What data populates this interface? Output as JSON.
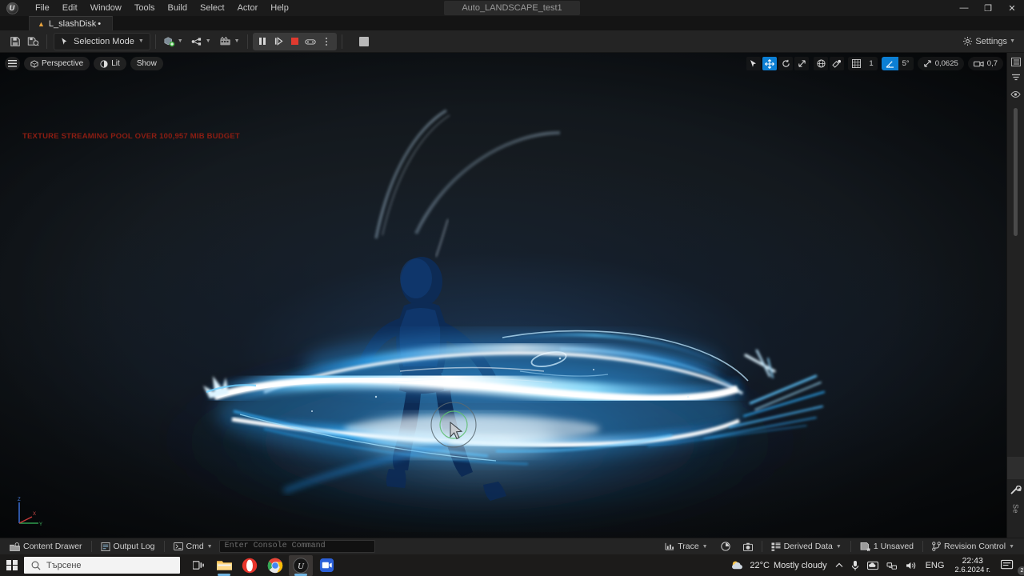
{
  "window": {
    "title": "Auto_LANDSCAPE_test1",
    "minimize": "—",
    "maximize": "❐",
    "close": "✕"
  },
  "menubar": {
    "items": [
      {
        "label": "File"
      },
      {
        "label": "Edit"
      },
      {
        "label": "Window"
      },
      {
        "label": "Tools"
      },
      {
        "label": "Build"
      },
      {
        "label": "Select"
      },
      {
        "label": "Actor"
      },
      {
        "label": "Help"
      }
    ]
  },
  "tab": {
    "label": "L_slashDisk",
    "dirty_marker": "•"
  },
  "toolbar": {
    "save_tooltip": "Save",
    "save_all_tooltip": "Save All",
    "selection_mode": "Selection Mode",
    "add_tooltip": "Add",
    "blueprints_tooltip": "Blueprints",
    "cinematics_tooltip": "Cinematics",
    "pause_tooltip": "Pause",
    "step_tooltip": "Frame Step",
    "stop_tooltip": "Stop",
    "eject_tooltip": "Eject / Possess",
    "more_tooltip": "More Options",
    "settings": "Settings"
  },
  "viewport": {
    "menu_tooltip": "Viewport Options",
    "perspective": "Perspective",
    "view_mode": "Lit",
    "show": "Show",
    "warning": "TEXTURE STREAMING POOL OVER 100,957 MIB BUDGET",
    "tools": {
      "select_tooltip": "Select Mode",
      "move_tooltip": "Translate Mode",
      "rotate_tooltip": "Rotate Mode",
      "scale_tooltip": "Scale Mode",
      "coordinate_tooltip": "World Coordinate System",
      "surface_snap_tooltip": "Surface Snapping",
      "grid_snap_tooltip": "Grid Snapping",
      "grid_value": "1",
      "angle_snap_tooltip": "Angle Snapping",
      "angle_value": "5°",
      "scale_snap_tooltip": "Scale Snapping",
      "scale_value": "0,0625",
      "camera_speed_tooltip": "Camera Speed",
      "camera_speed_value": "0,7"
    },
    "axis": {
      "x": "X",
      "y": "Y",
      "z": "Z"
    }
  },
  "right_sidebar": {
    "outliner_tooltip": "Outliner",
    "filter_tooltip": "Filter",
    "visibility_tooltip": "Visibility",
    "details_label": "Se"
  },
  "statusbar": {
    "content_drawer": "Content Drawer",
    "output_log": "Output Log",
    "cmd": "Cmd",
    "console_placeholder": "Enter Console Command",
    "trace": "Trace",
    "profile_tooltip": "Profile",
    "snapshot_tooltip": "Snapshot",
    "derived_data": "Derived Data",
    "unsaved": "1 Unsaved",
    "revision_control": "Revision Control"
  },
  "taskbar": {
    "search_placeholder": "Търсене",
    "task_view_tooltip": "Task View",
    "apps": [
      {
        "name": "file-explorer"
      },
      {
        "name": "opera"
      },
      {
        "name": "chrome"
      },
      {
        "name": "unreal-engine"
      },
      {
        "name": "media-app"
      }
    ],
    "weather_temp": "22°C",
    "weather_desc": "Mostly cloudy",
    "chevron_tooltip": "Show hidden icons",
    "mic_tooltip": "Microphone",
    "onedrive_tooltip": "OneDrive",
    "network_tooltip": "Network",
    "volume_tooltip": "Volume",
    "language": "ENG",
    "time": "22:43",
    "date": "2.6.2024 г.",
    "notification_count": "2"
  },
  "colors": {
    "accent_blue": "#0c7fd4",
    "warning_red": "#8c1d12",
    "vfx_cyan": "#28b6ff",
    "toolbar_bg": "#242424"
  }
}
